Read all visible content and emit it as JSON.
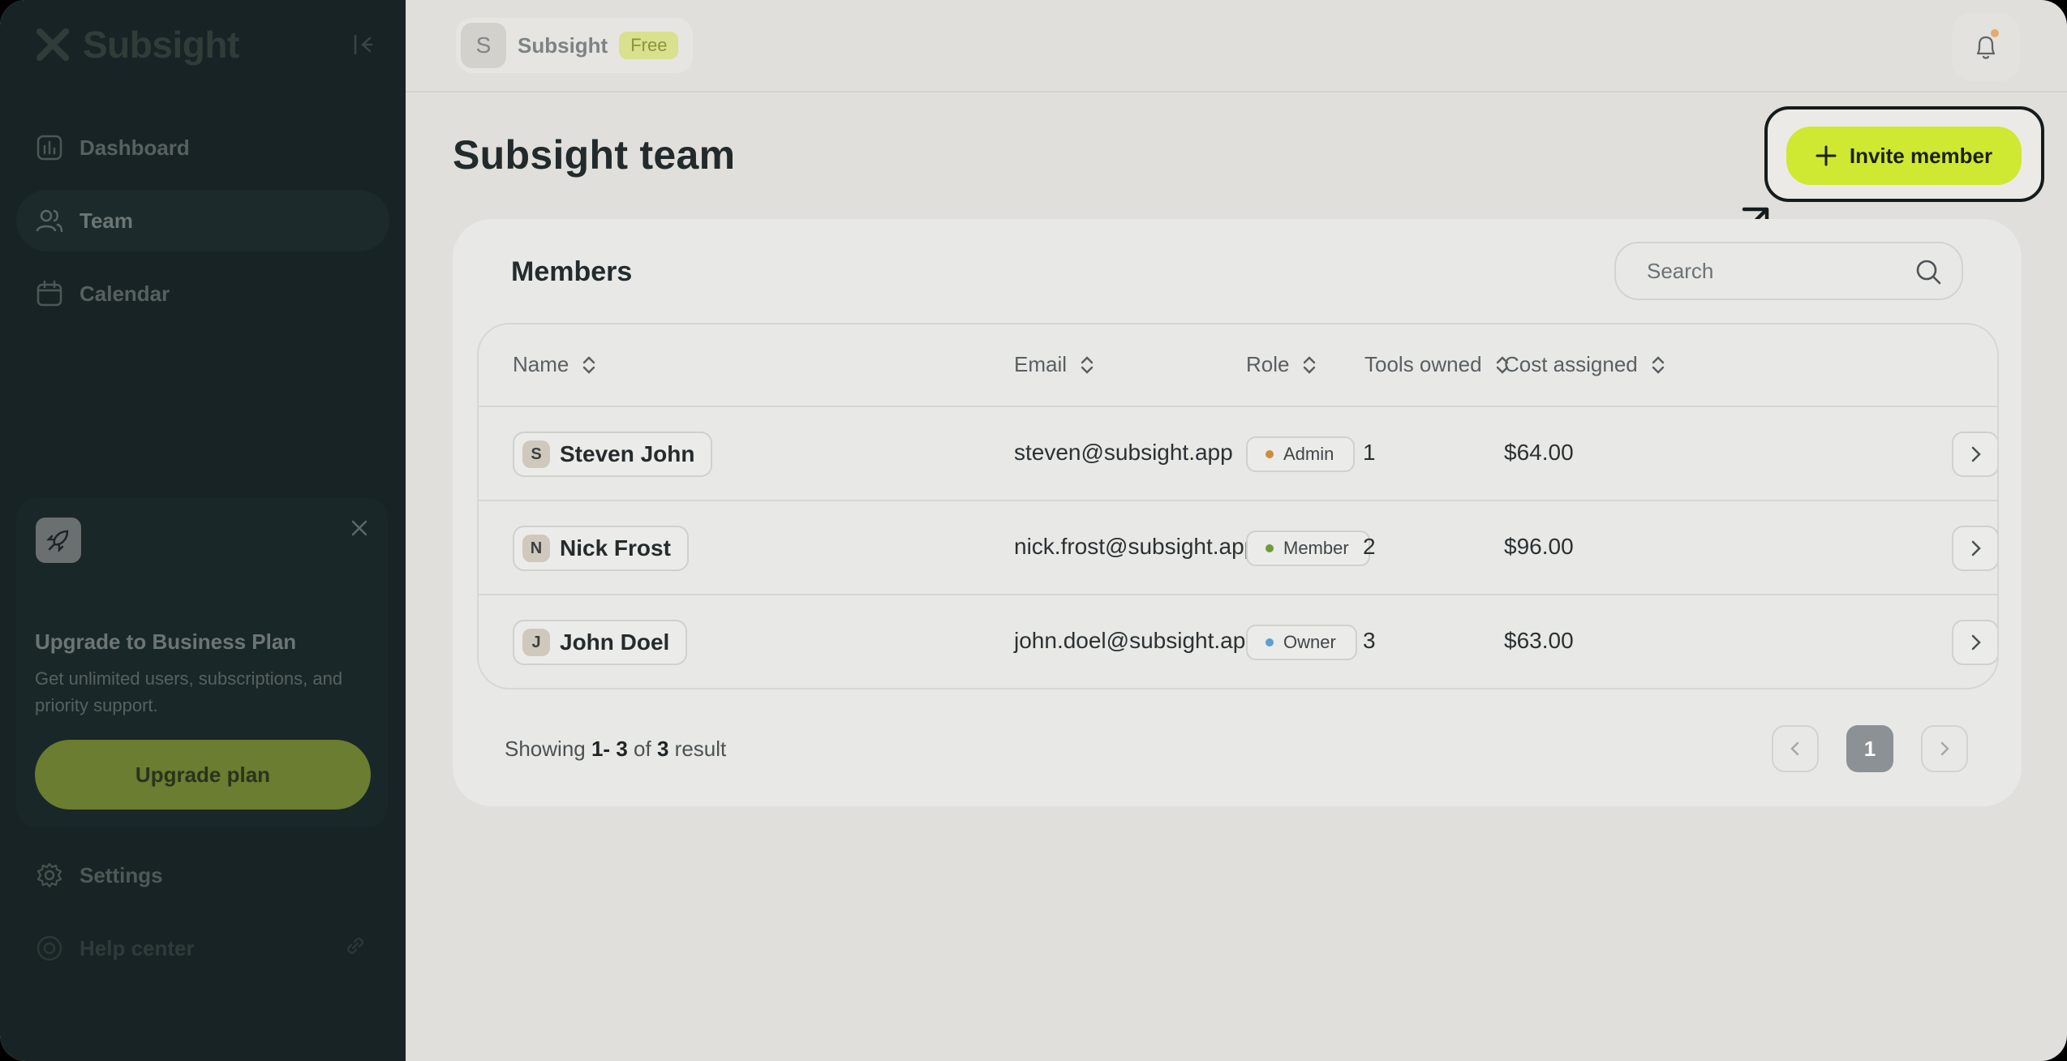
{
  "sidebar": {
    "brand": "Subsight",
    "nav": [
      {
        "label": "Dashboard",
        "icon": "chart-icon",
        "active": false
      },
      {
        "label": "Team",
        "icon": "users-icon",
        "active": true
      },
      {
        "label": "Calendar",
        "icon": "calendar-icon",
        "active": false
      }
    ],
    "upgrade_card": {
      "title": "Upgrade to Business Plan",
      "text": "Get unlimited users, subscriptions, and priority support.",
      "button": "Upgrade plan"
    },
    "settings": "Settings",
    "help": "Help center"
  },
  "topbar": {
    "workspace_initial": "S",
    "workspace_name": "Subsight",
    "plan_badge": "Free"
  },
  "page": {
    "title": "Subsight team",
    "invite_button": "Invite member"
  },
  "members": {
    "title": "Members",
    "search_placeholder": "Search",
    "columns": [
      "Name",
      "Email",
      "Role",
      "Tools owned",
      "Cost assigned"
    ],
    "rows": [
      {
        "initial": "S",
        "name": "Steven John",
        "email": "steven@subsight.app",
        "role": "Admin",
        "role_color": "#c98f3a",
        "tools": "1",
        "cost": "$64.00"
      },
      {
        "initial": "N",
        "name": "Nick Frost",
        "email": "nick.frost@subsight.app",
        "role": "Member",
        "role_color": "#6f9a3c",
        "tools": "2",
        "cost": "$96.00"
      },
      {
        "initial": "J",
        "name": "John Doel",
        "email": "john.doel@subsight.ap...",
        "role": "Owner",
        "role_color": "#5e9fd0",
        "tools": "3",
        "cost": "$63.00"
      }
    ],
    "pagination": {
      "showing_prefix": "Showing",
      "range_start": "1-",
      "range_end": "3",
      "of_word": "of",
      "total": "3",
      "suffix": "result",
      "current_page": "1"
    }
  },
  "colors": {
    "accent": "#cfe832",
    "sidebar": "#182326",
    "background": "#e0dfdb"
  }
}
